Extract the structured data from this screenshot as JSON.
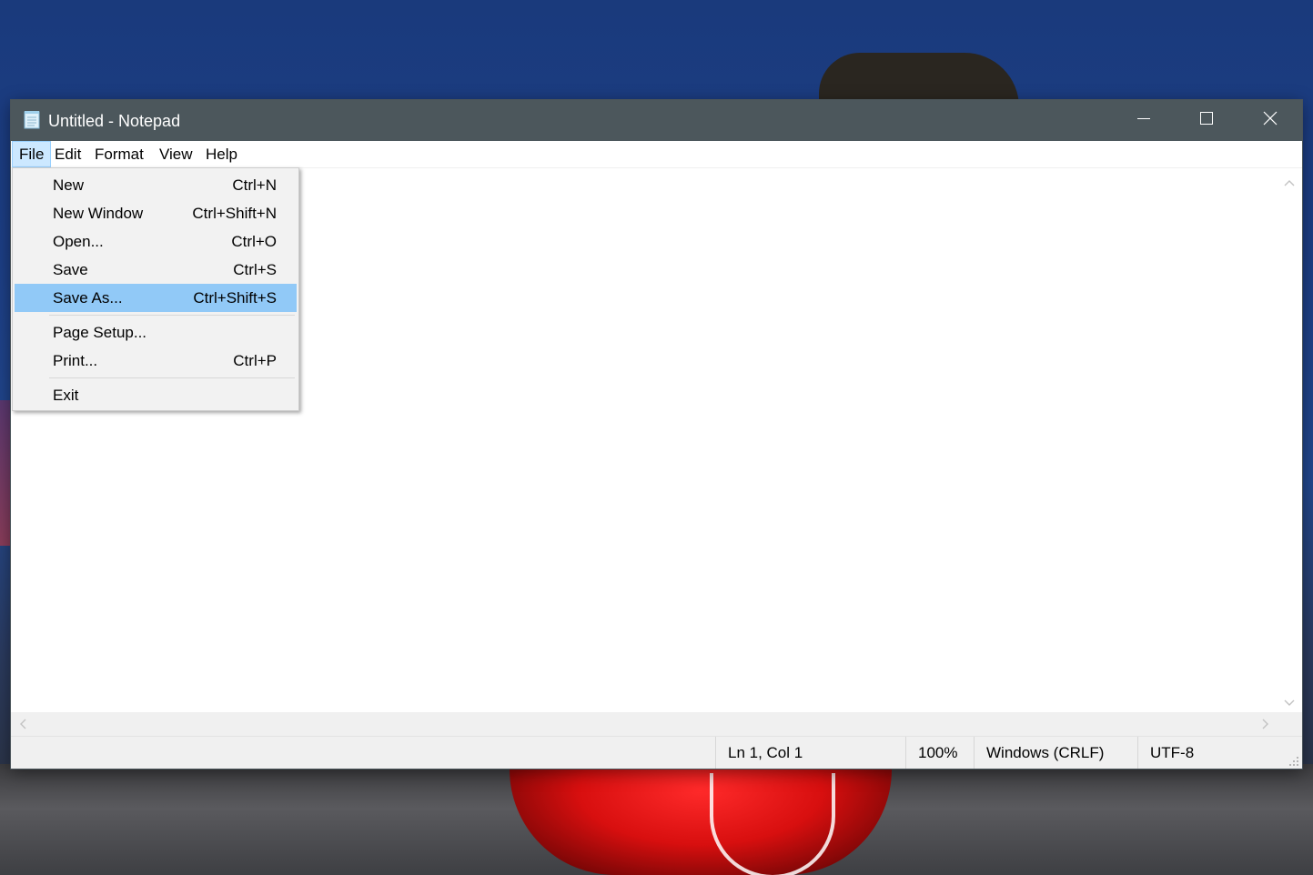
{
  "window": {
    "title": "Untitled - Notepad"
  },
  "menubar": {
    "items": [
      {
        "label": "File",
        "active": true
      },
      {
        "label": "Edit"
      },
      {
        "label": "Format"
      },
      {
        "label": "View"
      },
      {
        "label": "Help"
      }
    ]
  },
  "file_menu": {
    "items": [
      {
        "label": "New",
        "shortcut": "Ctrl+N"
      },
      {
        "label": "New Window",
        "shortcut": "Ctrl+Shift+N"
      },
      {
        "label": "Open...",
        "shortcut": "Ctrl+O"
      },
      {
        "label": "Save",
        "shortcut": "Ctrl+S"
      },
      {
        "label": "Save As...",
        "shortcut": "Ctrl+Shift+S",
        "highlighted": true
      },
      {
        "label": "Page Setup...",
        "shortcut": ""
      },
      {
        "label": "Print...",
        "shortcut": "Ctrl+P"
      },
      {
        "label": "Exit",
        "shortcut": ""
      }
    ]
  },
  "statusbar": {
    "position": "Ln 1, Col 1",
    "zoom": "100%",
    "line_ending": "Windows (CRLF)",
    "encoding": "UTF-8"
  },
  "icons": {
    "app": "notepad-icon",
    "minimize": "minimize-icon",
    "maximize": "maximize-icon",
    "close": "close-icon"
  },
  "colors": {
    "titlebar": "#4c575c",
    "menu_active": "#cce8ff",
    "menu_highlight": "#91c9f7",
    "menu_background": "#f2f2f2",
    "statusbar": "#f0f0f0"
  }
}
